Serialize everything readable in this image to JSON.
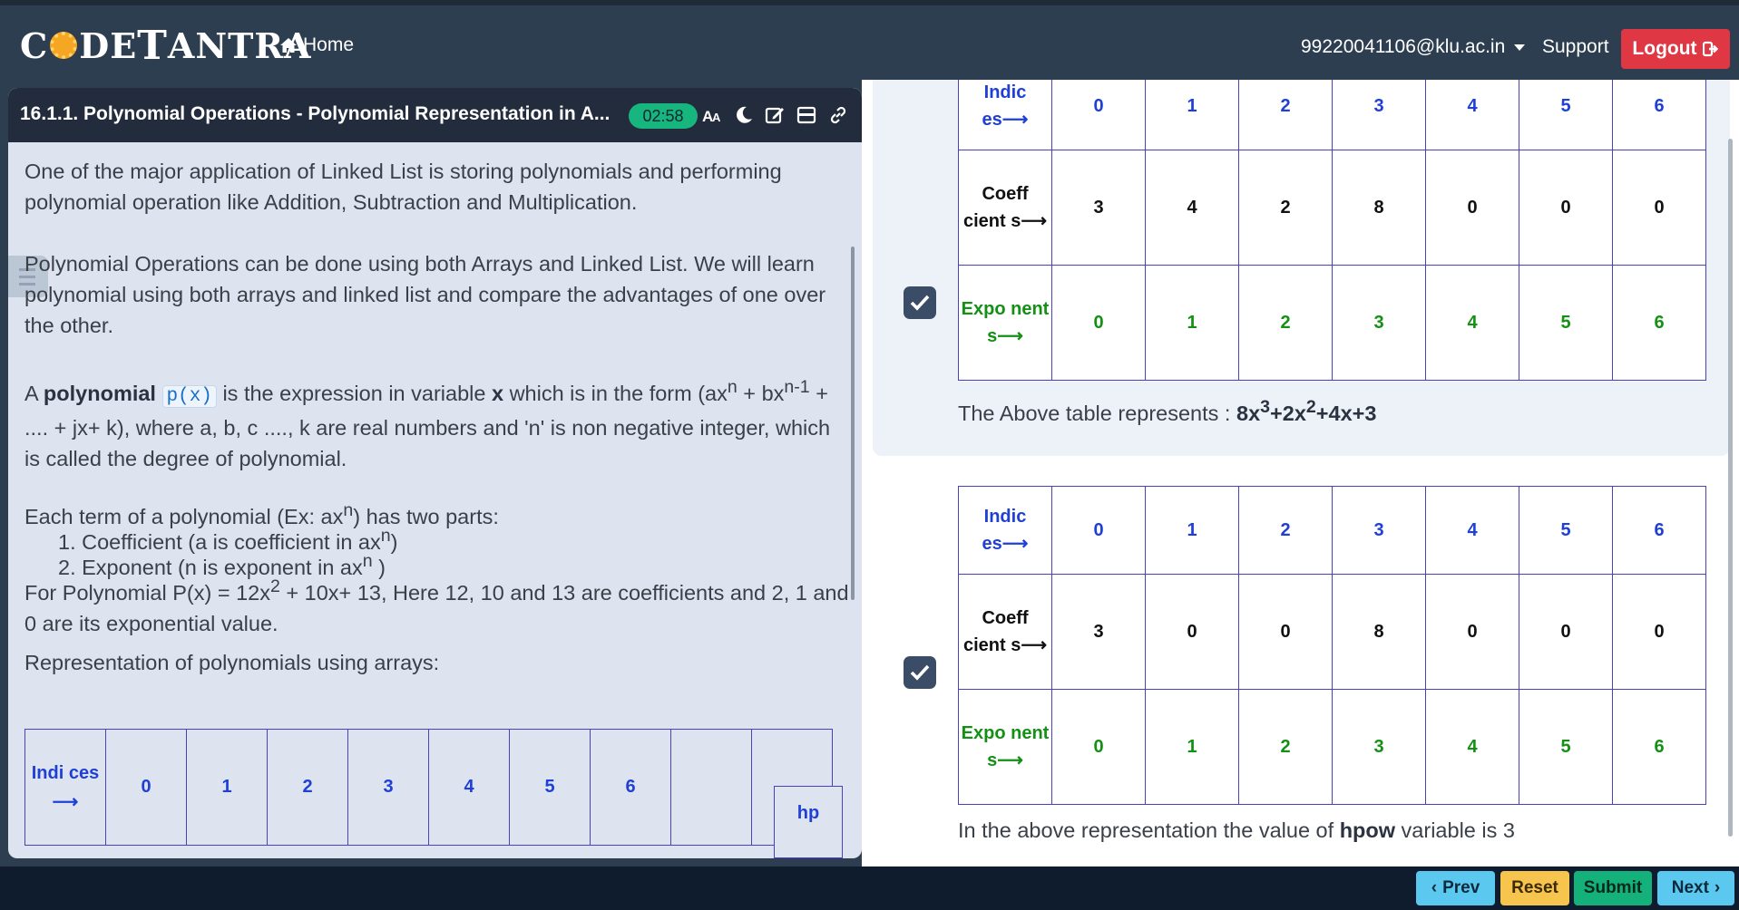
{
  "nav": {
    "brand": "CODETANTRA",
    "home_label": "Home",
    "user_email": "99220041106@klu.ac.in",
    "support_label": "Support",
    "logout_label": "Logout"
  },
  "question": {
    "title": "16.1.1. Polynomial Operations - Polynomial Representation in A...",
    "timer": "02:58"
  },
  "content": {
    "p1": "One of the major application of Linked List is storing polynomials and performing polynomial operation like Addition, Subtraction and Multiplication.",
    "p2": "Polynomial Operations can be done using both Arrays and Linked List. We will learn polynomial using both arrays and linked list and compare the advantages of one over the other.",
    "p3_a": "A ",
    "p3_bold": "polynomial",
    "p3_code": "p(x)",
    "p3_b": " is the expression in variable ",
    "p3_x": "x",
    "p3_c": " which is in the form (ax",
    "p3_sup1": "n",
    "p3_d": " + bx",
    "p3_sup2": "n-1",
    "p3_e": " + .... + jx+ k), where a, b, c ...., k are real numbers and 'n' is non negative integer, which is called the degree of polynomial.",
    "p4_a": "Each term of a polynomial (Ex: ax",
    "p4_sup": "n",
    "p4_b": ") has two parts:",
    "li1_a": "1. Coefficient (a is coefficient in ax",
    "li1_sup": "n",
    "li1_b": ")",
    "li2_a": "2. Exponent (n is exponent in ax",
    "li2_sup": "n",
    "li2_b": " )",
    "p5_a": "For Polynomial P(x) = 12x",
    "p5_sup": "2",
    "p5_b": " + 10x+ 13, Here 12, 10 and 13 are coefficients and 2, 1 and 0 are its exponential value.",
    "p6": "Representation of polynomials using arrays:",
    "arr_table_header": "Indi ces ⟶",
    "arr_table_values": [
      "0",
      "1",
      "2",
      "3",
      "4",
      "5",
      "6",
      "",
      ""
    ],
    "hp_label": "hp"
  },
  "options": [
    {
      "selected": true,
      "header_indices": "Indic es⟶",
      "header_coeff": "Coeff cient s⟶",
      "header_expo": "Expo nent s⟶",
      "indices": [
        "0",
        "1",
        "2",
        "3",
        "4",
        "5",
        "6"
      ],
      "coefficients": [
        "3",
        "4",
        "2",
        "8",
        "0",
        "0",
        "0"
      ],
      "exponents": [
        "0",
        "1",
        "2",
        "3",
        "4",
        "5",
        "6"
      ],
      "caption_a": "The Above table represents : ",
      "caption_bold_a": "8x",
      "caption_sup1": "3",
      "caption_bold_b": "+2x",
      "caption_sup2": "2",
      "caption_bold_c": "+4x+3"
    },
    {
      "selected": true,
      "header_indices": "Indic es⟶",
      "header_coeff": "Coeff cient s⟶",
      "header_expo": "Expo nent s⟶",
      "indices": [
        "0",
        "1",
        "2",
        "3",
        "4",
        "5",
        "6"
      ],
      "coefficients": [
        "3",
        "0",
        "0",
        "8",
        "0",
        "0",
        "0"
      ],
      "exponents": [
        "0",
        "1",
        "2",
        "3",
        "4",
        "5",
        "6"
      ],
      "caption_a": "In the above representation the value of ",
      "caption_bold": "hpow",
      "caption_b": " variable is 3"
    }
  ],
  "footer": {
    "prev_label": "Prev",
    "reset_label": "Reset",
    "submit_label": "Submit",
    "next_label": "Next"
  },
  "colors": {
    "nav_bg": "#2c3e50",
    "logout": "#e03744",
    "timer": "#16b67e",
    "table_border": "#4a42b8",
    "index_text": "#1f3fd6",
    "exponent_text": "#149014",
    "prev_next": "#5bc8ef",
    "reset": "#f7c44d",
    "submit": "#14b27a"
  }
}
